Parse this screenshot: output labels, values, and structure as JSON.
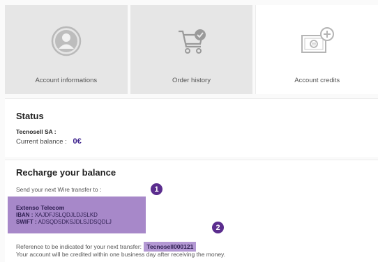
{
  "tiles": [
    {
      "label": "Account informations",
      "icon": "user-avatar-icon",
      "active": false
    },
    {
      "label": "Order history",
      "icon": "cart-check-icon",
      "active": false
    },
    {
      "label": "Account credits",
      "icon": "card-plus-icon",
      "active": true
    }
  ],
  "status": {
    "title": "Status",
    "company": "Tecnosell SA :",
    "balance_label": "Current balance :",
    "balance_value": "0€"
  },
  "recharge": {
    "title": "Recharge your balance",
    "send_text": "Send your next Wire transfer to :",
    "bank_name": "Extenso Telecom",
    "iban_label": "IBAN :",
    "iban_value": "XAJDFJSLQDJLDJSLKD",
    "swift_label": "SWIFT :",
    "swift_value": "ADSQDSDKSJDLSJDSQDLJ",
    "reference_text": "Reference to be indicated for your next transfer:",
    "reference_code": "Tecnosell000121",
    "credit_text": "Your account will be credited within one business day after receiving the money.",
    "badge_1": "1",
    "badge_2": "2"
  },
  "colors": {
    "accent": "#3a1f8c",
    "badge": "#5b2d8e",
    "highlight": "#a788c9",
    "tile_bg": "#e6e6e6"
  }
}
